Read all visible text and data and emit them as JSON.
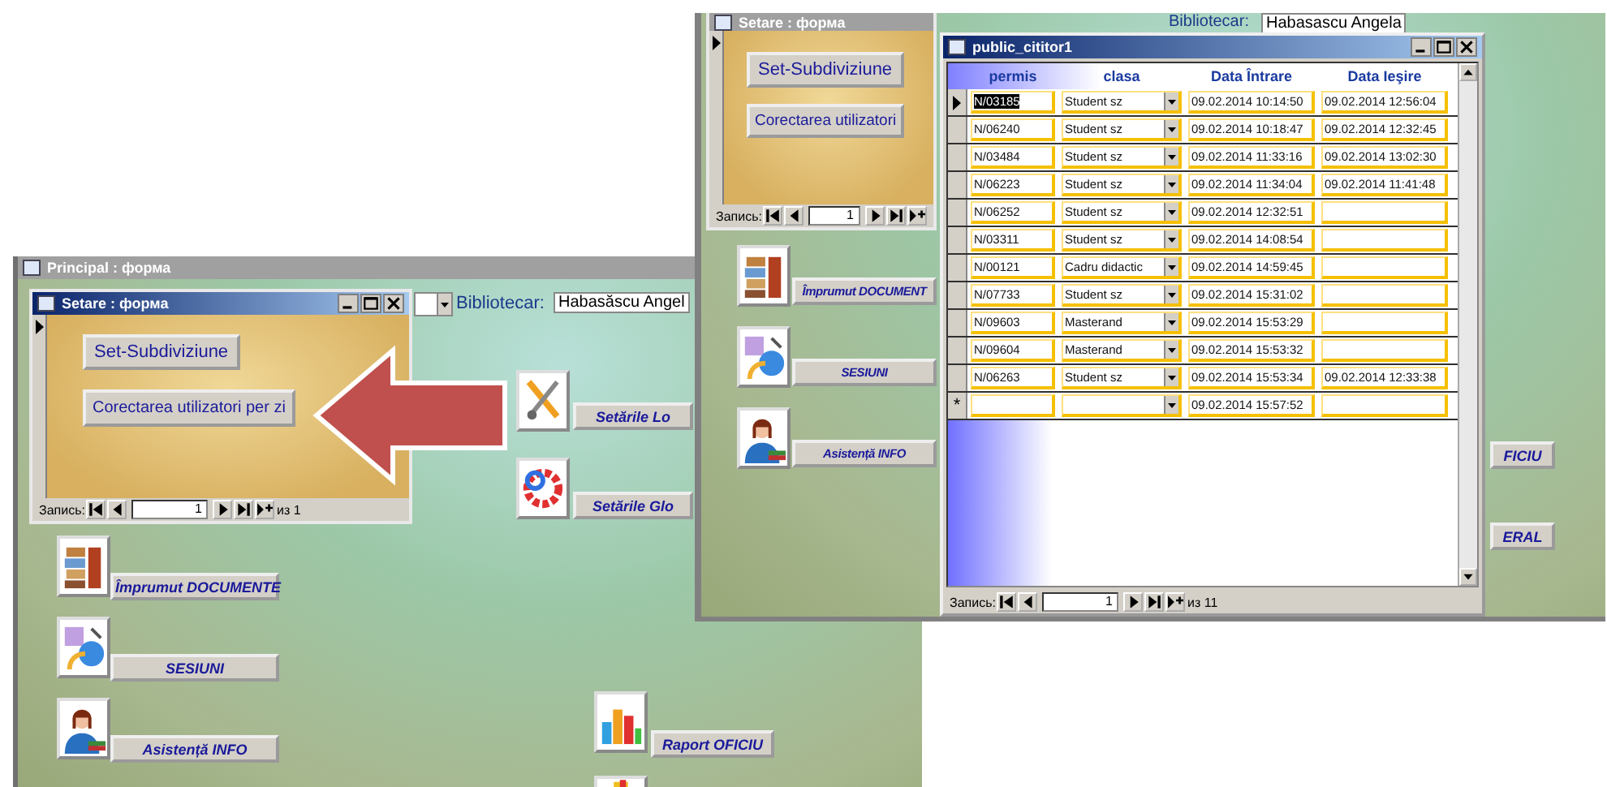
{
  "left_screen": {
    "title": "Principal : форма",
    "subform": {
      "title": "Setare : форма",
      "buttons": [
        "Set-Subdiviziune",
        "Corectarea utilizatori per zi"
      ],
      "nav": {
        "label": "Запись:",
        "value": "1",
        "total": "из 1"
      }
    },
    "librarian": {
      "label": "Bibliotecar:",
      "value": "Habasăscu Angel"
    },
    "menu": [
      {
        "label": "Setările Lo",
        "kind": "tools"
      },
      {
        "label": "Setările Glo",
        "kind": "gear"
      },
      {
        "label": "Împrumut DOCUMENTE",
        "kind": "books"
      },
      {
        "label": "SESIUNI",
        "kind": "network"
      },
      {
        "label": "Asistență INFO",
        "kind": "person"
      },
      {
        "label": "Raport OFICIU",
        "kind": "chart"
      }
    ]
  },
  "right_screen": {
    "subform": {
      "title": "Setare : форма",
      "buttons": [
        "Set-Subdiviziune",
        "Corectarea utilizatori"
      ],
      "nav": {
        "label": "Запись:",
        "value": "1"
      }
    },
    "librarian": {
      "label": "Bibliotecar:",
      "value": "Habasascu Angela"
    },
    "menu": [
      {
        "label": "Împrumut DOCUMENT",
        "kind": "books"
      },
      {
        "label": "SESIUNI",
        "kind": "network"
      },
      {
        "label": "Asistență INFO",
        "kind": "person"
      }
    ],
    "side_buttons": [
      "FICIU",
      "ERAL"
    ],
    "table_window": {
      "title": "public_cititor1",
      "columns": [
        "permis",
        "clasa",
        "Data Întrare",
        "Data Ieşire"
      ],
      "rows": [
        {
          "permis": "N/03185",
          "clasa": "Student sz",
          "data_intrare": "09.02.2014 10:14:50",
          "data_iesire": "09.02.2014 12:56:04",
          "selected": true
        },
        {
          "permis": "N/06240",
          "clasa": "Student sz",
          "data_intrare": "09.02.2014 10:18:47",
          "data_iesire": "09.02.2014 12:32:45",
          "selected": false
        },
        {
          "permis": "N/03484",
          "clasa": "Student sz",
          "data_intrare": "09.02.2014 11:33:16",
          "data_iesire": "09.02.2014 13:02:30",
          "selected": false
        },
        {
          "permis": "N/06223",
          "clasa": "Student sz",
          "data_intrare": "09.02.2014 11:34:04",
          "data_iesire": "09.02.2014 11:41:48",
          "selected": false
        },
        {
          "permis": "N/06252",
          "clasa": "Student sz",
          "data_intrare": "09.02.2014 12:32:51",
          "selected": false
        },
        {
          "permis": "N/03311",
          "clasa": "Student sz",
          "data_intrare": "09.02.2014 14:08:54",
          "selected": false
        },
        {
          "permis": "N/00121",
          "clasa": "Cadru didactic",
          "data_intrare": "09.02.2014 14:59:45",
          "selected": false
        },
        {
          "permis": "N/07733",
          "clasa": "Student sz",
          "data_intrare": "09.02.2014 15:31:02",
          "selected": false
        },
        {
          "permis": "N/09603",
          "clasa": "Masterand",
          "data_intrare": "09.02.2014 15:53:29",
          "selected": false
        },
        {
          "permis": "N/09604",
          "clasa": "Masterand",
          "data_intrare": "09.02.2014 15:53:32",
          "selected": false
        },
        {
          "permis": "N/06263",
          "clasa": "Student sz",
          "data_intrare": "09.02.2014 15:53:34",
          "data_iesire": "09.02.2014 12:33:38",
          "selected": false
        }
      ],
      "new_row": {
        "marker": "*",
        "data_intrare": "09.02.2014 15:57:52"
      },
      "nav": {
        "label": "Запись:",
        "value": "1",
        "total": "из 11"
      }
    }
  }
}
